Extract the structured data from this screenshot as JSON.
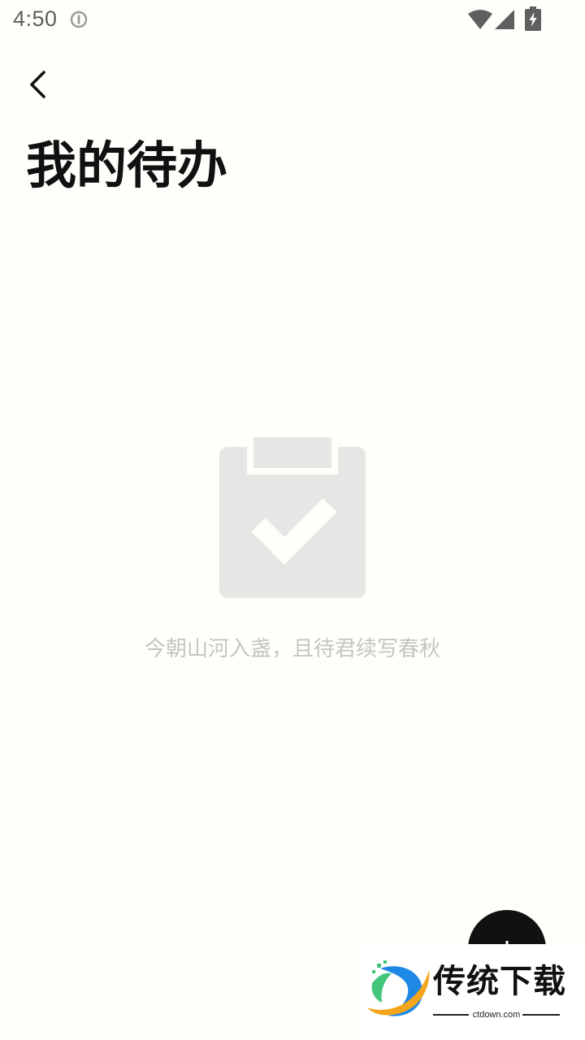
{
  "status_bar": {
    "time": "4:50",
    "icons": [
      "info-icon",
      "wifi-icon",
      "signal-icon",
      "battery-charging-icon"
    ],
    "icon_color": "#5f5f5f"
  },
  "header": {
    "back_icon": "chevron-left-icon",
    "title": "我的待办"
  },
  "empty_state": {
    "icon": "clipboard-check-icon",
    "message": "今朝山河入盏，且待君续写春秋",
    "icon_color": "#e6e6e4",
    "text_color": "#c4c4c2"
  },
  "fab": {
    "icon": "plus-icon",
    "color": "#111111"
  },
  "watermark": {
    "name": "传统下载",
    "url": "ctdown.com"
  },
  "colors": {
    "background": "#fffefa",
    "title": "#111111"
  }
}
